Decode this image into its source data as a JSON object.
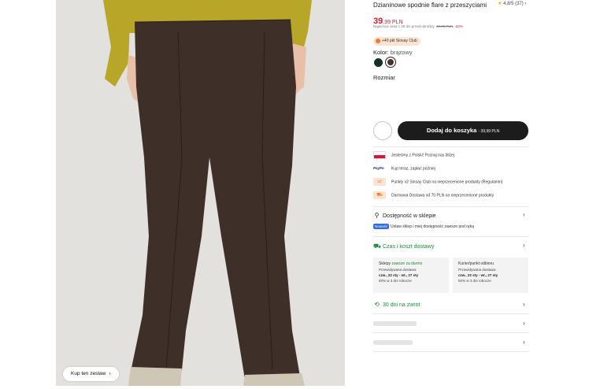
{
  "product": {
    "title": "Dzianinowe spodnie flare z przeszyciami",
    "rating": "4,8/5",
    "rating_count": "(37)",
    "price_int": "39",
    "price_rest": ",99 PLN",
    "lowest_text": "Najniższa cena z 30 dni przed obniżką:",
    "old_price": "49,99 PLN",
    "discount": "-20%",
    "club_badge": "+40 pkt Sinsay Club",
    "color_label": "Kolor:",
    "color_value": "brązowy",
    "size_label": "Rozmiar",
    "set_button": "Kup ten zestaw",
    "swatches": [
      "#123126",
      "#4a332a"
    ]
  },
  "actions": {
    "add_to_cart": "Dodaj do koszyka",
    "add_to_cart_price": "- 39,99 PLN"
  },
  "info_rows": [
    {
      "icon": "poland-flag-icon",
      "text": "Jesteśmy z Polski! Poznaj nas bliżej"
    },
    {
      "icon": "paypo-icon",
      "icon_text": "PayPo",
      "text": "Kup teraz, zapłać później"
    },
    {
      "icon": "points-icon",
      "icon_text": "x2",
      "text": "Punkty x2 Sinsay Club na nieprzecenione produkty (Regulamin)"
    },
    {
      "icon": "truck-icon",
      "text": "Darmowa Dostawa od 70 PLN na nieprzecenione produkty"
    }
  ],
  "store": {
    "title": "Dostępność w sklepie",
    "badge": "Nowość",
    "subtitle": "Ustaw sklep i miej dostępność zawsze pod ręką"
  },
  "delivery": {
    "title": "Czas i koszt dostawy",
    "boxes": [
      {
        "name": "Sklepy",
        "note": "zawsze za darmo",
        "label": "Przewidywana dostawa:",
        "dates": "czw., 22 sty - wt., 27 sty",
        "pct": "93% w 3 dni robocze"
      },
      {
        "name": "Kurier/punkt odbioru",
        "note": "",
        "label": "Przewidywana dostawa:",
        "dates": "czw., 22 sty - wt., 27 sty",
        "pct": "92% w 3 dni robocze"
      }
    ]
  },
  "returns": {
    "title": "30 dni na zwrot"
  },
  "colors": {
    "price_red": "#d6202c",
    "accent_green": "#1c8b3b",
    "club_orange": "#f27c2a",
    "button_dark": "#1c1c1c"
  }
}
